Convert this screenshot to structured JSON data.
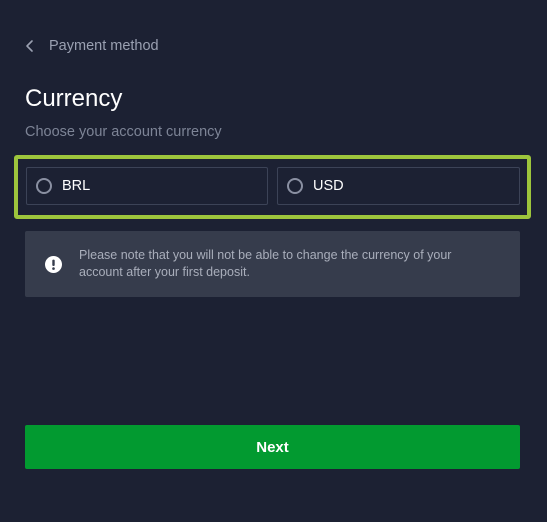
{
  "header": {
    "back_label": "Payment method",
    "back_icon": "chevron-left-icon"
  },
  "currency": {
    "title": "Currency",
    "subtitle": "Choose your account currency",
    "options": [
      {
        "label": "BRL",
        "selected": false
      },
      {
        "label": "USD",
        "selected": false
      }
    ]
  },
  "notice": {
    "icon": "exclamation-circle-icon",
    "text": "Please note that you will not be able to change the currency of your account after your first deposit."
  },
  "actions": {
    "next_label": "Next"
  },
  "colors": {
    "background": "#1c2133",
    "highlight": "#9dc53c",
    "primary_button": "#029a30",
    "notice_background": "#363c4c"
  }
}
